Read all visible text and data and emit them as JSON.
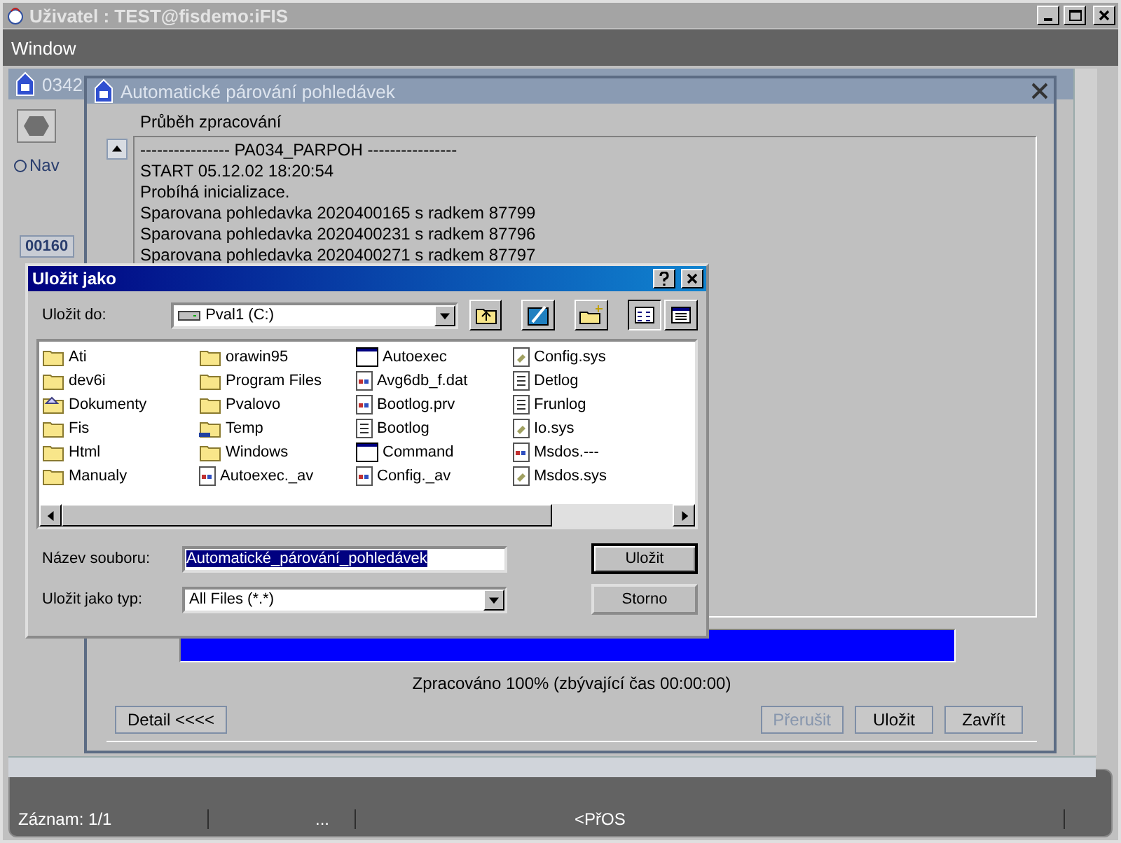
{
  "app_window": {
    "title": "Uživatel : TEST@fisdemo:iFIS"
  },
  "menu": [
    {
      "label": "Window"
    }
  ],
  "background_window": {
    "title": "0342",
    "radio": {
      "label": "Nav",
      "selected": false
    },
    "badge": "00160"
  },
  "process_dialog": {
    "title": "Automatické párování pohledávek",
    "section_label": "Průběh zpracování",
    "log": [
      "---------------- PA034_PARPOH ----------------",
      "START 05.12.02 18:20:54",
      "Probíhá inicializace.",
      "Sparovana pohledavka 2020400165 s radkem 87799",
      "Sparovana pohledavka 2020400231 s radkem 87796",
      "Sparovana pohledavka 2020400271 s radkem 87797"
    ],
    "progress": {
      "level": 1,
      "caption": "Zpracováno 100% (zbývající čas 00:00:00)"
    },
    "buttons": [
      {
        "label": "Detail  <<<<",
        "disabled": false,
        "kind": "left"
      },
      {
        "label": "Přerušit",
        "disabled": true,
        "kind": "right"
      },
      {
        "label": "Uložit",
        "disabled": false,
        "kind": "right"
      },
      {
        "label": "Zavřít",
        "disabled": false,
        "kind": "right"
      }
    ]
  },
  "save_dialog": {
    "title": "Uložit jako",
    "save_in_label": "Uložit do:",
    "save_in_value": "Pval1 (C:)",
    "files": [
      {
        "name": "Ati",
        "kind": "folder"
      },
      {
        "name": "dev6i",
        "kind": "folder"
      },
      {
        "name": "Dokumenty",
        "kind": "shared-folder"
      },
      {
        "name": "Fis",
        "kind": "folder"
      },
      {
        "name": "Html",
        "kind": "folder"
      },
      {
        "name": "Manualy",
        "kind": "folder"
      },
      {
        "name": "orawin95",
        "kind": "folder"
      },
      {
        "name": "Program Files",
        "kind": "folder"
      },
      {
        "name": "Pvalovo",
        "kind": "folder"
      },
      {
        "name": "Temp",
        "kind": "network-folder"
      },
      {
        "name": "Windows",
        "kind": "folder"
      },
      {
        "name": "Autoexec._av",
        "kind": "data"
      },
      {
        "name": "Autoexec",
        "kind": "program"
      },
      {
        "name": "Avg6db_f.dat",
        "kind": "data"
      },
      {
        "name": "Bootlog.prv",
        "kind": "data"
      },
      {
        "name": "Bootlog",
        "kind": "text"
      },
      {
        "name": "Command",
        "kind": "program"
      },
      {
        "name": "Config._av",
        "kind": "data"
      },
      {
        "name": "Config.sys",
        "kind": "system"
      },
      {
        "name": "Detlog",
        "kind": "text"
      },
      {
        "name": "Frunlog",
        "kind": "text"
      },
      {
        "name": "Io.sys",
        "kind": "system"
      },
      {
        "name": "Msdos.---",
        "kind": "data"
      },
      {
        "name": "Msdos.sys",
        "kind": "system"
      }
    ],
    "filename_label": "Název souboru:",
    "filename": {
      "value": "Automatické_párování_pohledávek",
      "selected": true
    },
    "filetype_label": "Uložit jako typ:",
    "filetype_value": "All Files (*.*)",
    "buttons": [
      {
        "label": "Uložit",
        "default": true
      },
      {
        "label": "Storno",
        "default": false
      }
    ]
  },
  "status_bar": {
    "record": "Záznam: 1/1",
    "ellipsis": "...",
    "mode": "<PřOS"
  }
}
